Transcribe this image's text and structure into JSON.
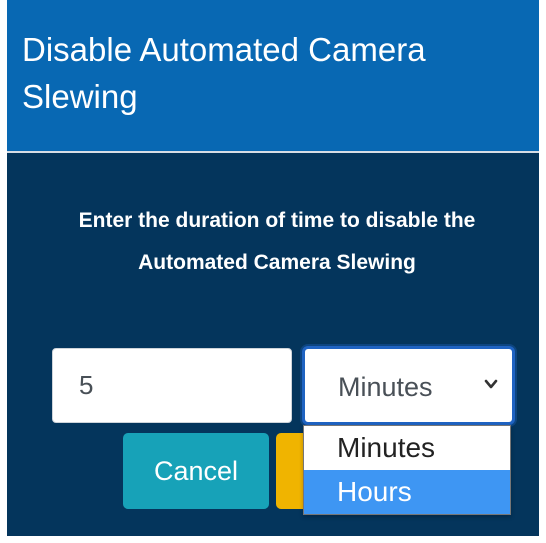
{
  "dialog": {
    "title": "Disable Automated Camera Slewing",
    "prompt": "Enter the duration of time to disable the Automated Camera Slewing",
    "duration_value": "5",
    "unit_select": {
      "selected": "Minutes",
      "options": [
        {
          "label": "Minutes",
          "highlighted": false
        },
        {
          "label": "Hours",
          "highlighted": true
        }
      ]
    },
    "cancel_label": "Cancel",
    "confirm_label": ""
  },
  "colors": {
    "header_bg": "#0868b3",
    "body_bg": "#04355c",
    "cancel_bg": "#17a2b8",
    "confirm_bg": "#f0b400",
    "option_highlight": "#3e96f3"
  }
}
